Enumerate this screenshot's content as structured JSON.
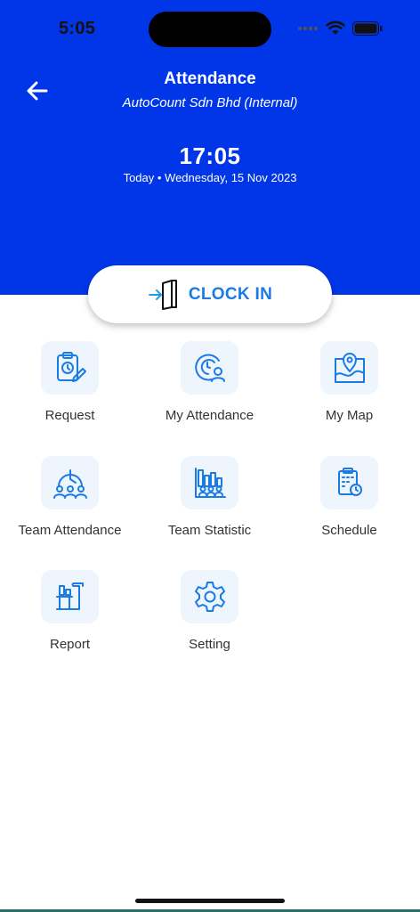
{
  "status_bar": {
    "time": "5:05"
  },
  "header": {
    "title": "Attendance",
    "subtitle": "AutoCount Sdn Bhd (Internal)",
    "clock_time": "17:05",
    "date_line": "Today • Wednesday, 15 Nov 2023",
    "background_color": "#0036e8"
  },
  "clock_in": {
    "label": "CLOCK IN",
    "icon": "clock-in-door-icon",
    "color": "#1b7be4"
  },
  "menu": [
    {
      "label": "Request",
      "icon": "request-clipboard-icon"
    },
    {
      "label": "My Attendance",
      "icon": "my-attendance-icon"
    },
    {
      "label": "My Map",
      "icon": "my-map-icon"
    },
    {
      "label": "Team Attendance",
      "icon": "team-attendance-icon"
    },
    {
      "label": "Team Statistic",
      "icon": "team-statistic-icon"
    },
    {
      "label": "Schedule",
      "icon": "schedule-icon"
    },
    {
      "label": "Report",
      "icon": "report-icon"
    },
    {
      "label": "Setting",
      "icon": "setting-gear-icon"
    }
  ],
  "colors": {
    "icon_blue": "#1b7be4",
    "icon_box_bg": "#eef5fd"
  }
}
